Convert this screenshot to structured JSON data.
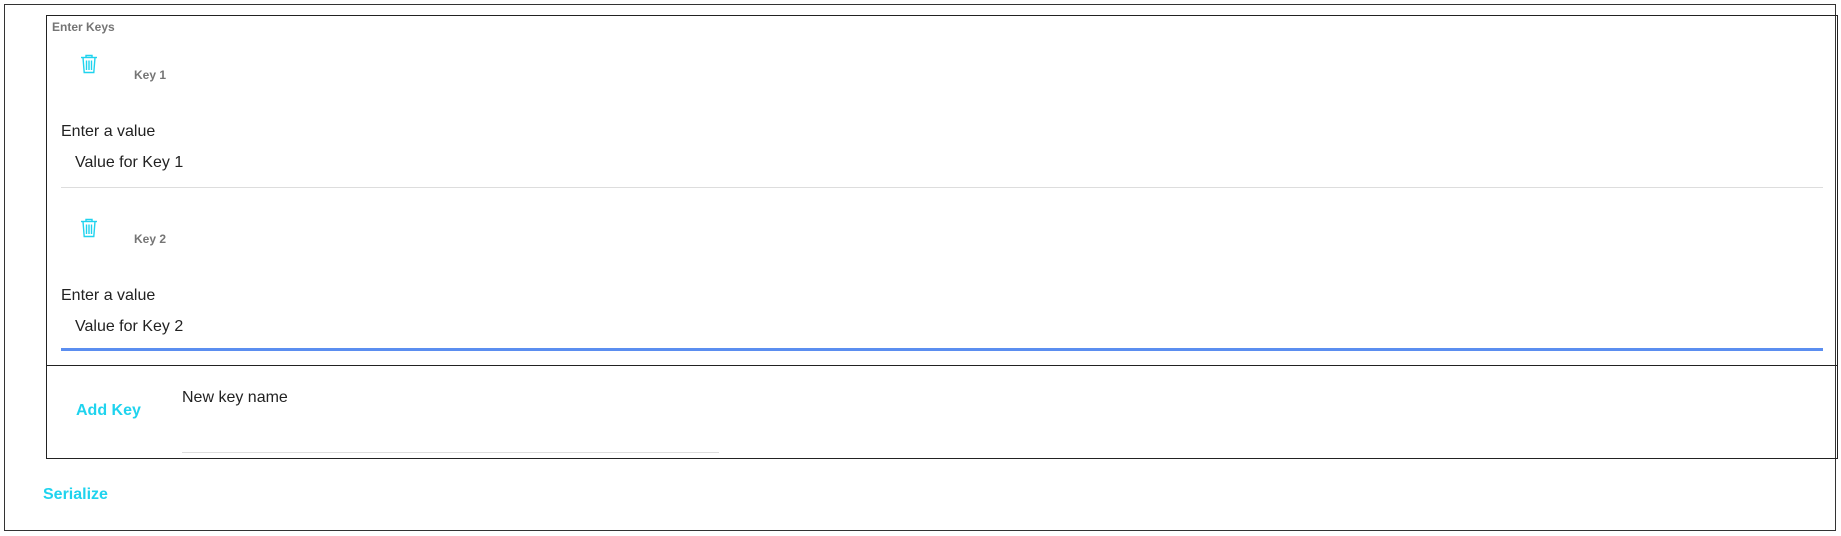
{
  "form": {
    "legend": "Enter Keys",
    "keys": [
      {
        "name": "Key 1",
        "value_label": "Enter a value",
        "value": "Value for Key 1",
        "delete_icon": "trash-icon"
      },
      {
        "name": "Key 2",
        "value_label": "Enter a value",
        "value": "Value for Key 2",
        "delete_icon": "trash-icon"
      }
    ],
    "add_key_label": "Add Key",
    "new_key_label": "New key name",
    "new_key_value": ""
  },
  "serialize_label": "Serialize",
  "colors": {
    "accent": "#1fd3ee",
    "focus_underline": "#5b8ef0",
    "muted_text": "#757575"
  }
}
